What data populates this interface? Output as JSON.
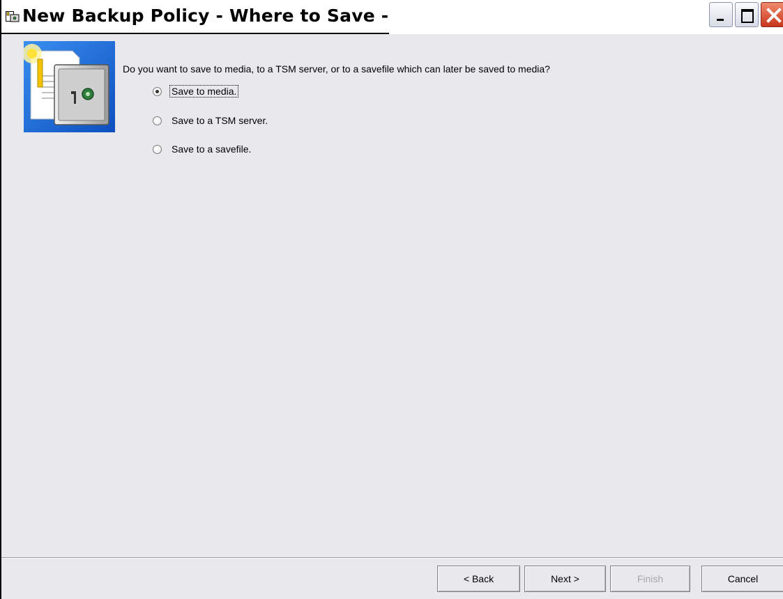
{
  "window": {
    "title": "New Backup Policy - Where to Save -"
  },
  "page": {
    "question": "Do you want to save to media, to a TSM server, or to a savefile which can later be saved to media?",
    "options": [
      {
        "label": "Save to media.",
        "selected": true
      },
      {
        "label": "Save to a TSM server.",
        "selected": false
      },
      {
        "label": "Save to a savefile.",
        "selected": false
      }
    ]
  },
  "buttons": {
    "back": "< Back",
    "next": "Next >",
    "finish": "Finish",
    "cancel": "Cancel"
  },
  "icons": {
    "title": "backup-policy-icon",
    "wizard": "safe-with-documents-icon"
  },
  "colors": {
    "background": "#e9e8ec",
    "close_button": "#c8361c",
    "wizard_image_blue": "#1e6fd6",
    "disabled_text": "#a8a8a8"
  }
}
